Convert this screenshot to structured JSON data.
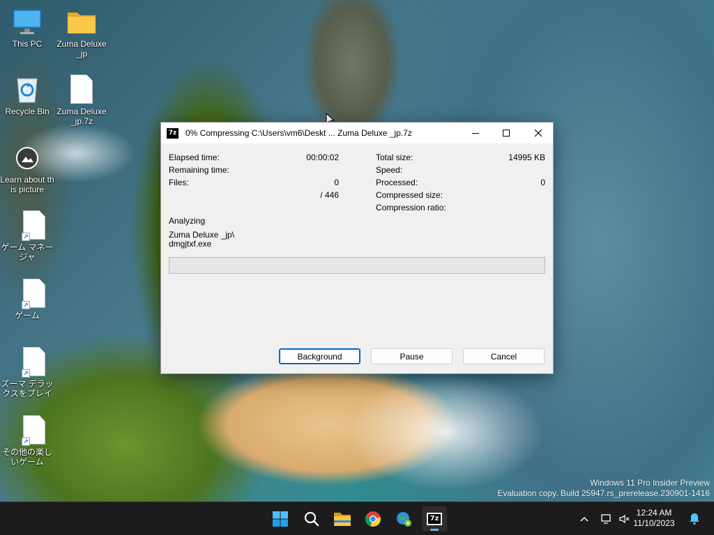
{
  "desktop": {
    "icons": [
      {
        "label": "This PC",
        "icon": "monitor-icon"
      },
      {
        "label": "Zuma Deluxe _jp",
        "icon": "folder-icon"
      },
      {
        "label": "Recycle Bin",
        "icon": "recycle-bin-icon"
      },
      {
        "label": "Zuma Deluxe _jp.7z",
        "icon": "file-icon"
      },
      {
        "label": "Learn about this picture",
        "icon": "camera-icon"
      },
      {
        "label": "ゲーム マネージャ",
        "icon": "shortcut-file-icon"
      },
      {
        "label": "ゲーム",
        "icon": "shortcut-file-icon"
      },
      {
        "label": "ズーマ デラックスをプレイ",
        "icon": "shortcut-file-icon"
      },
      {
        "label": "その他の楽しいゲーム",
        "icon": "shortcut-file-icon"
      }
    ],
    "watermark": {
      "line1": "Windows 11 Pro Insider Preview",
      "line2": "Evaluation copy. Build 25947.rs_prerelease.230901-1416"
    }
  },
  "dialog": {
    "title": "0% Compressing C:\\Users\\vm6\\Deskt ... Zuma Deluxe _jp.7z",
    "app_icon_text": "7z",
    "left_stats": {
      "elapsed_label": "Elapsed time:",
      "elapsed_value": "00:00:02",
      "remaining_label": "Remaining time:",
      "remaining_value": "",
      "files_label": "Files:",
      "files_value": "0",
      "files_total": "/ 446"
    },
    "right_stats": {
      "total_size_label": "Total size:",
      "total_size_value": "14995 KB",
      "speed_label": "Speed:",
      "speed_value": "",
      "processed_label": "Processed:",
      "processed_value": "0",
      "compressed_size_label": "Compressed size:",
      "compressed_size_value": "",
      "ratio_label": "Compression ratio:",
      "ratio_value": ""
    },
    "status": "Analyzing",
    "current_file_line1": "Zuma Deluxe _jp\\",
    "current_file_line2": "dmgjtxf.exe",
    "progress_percent": 0,
    "buttons": {
      "background": "Background",
      "pause": "Pause",
      "cancel": "Cancel"
    }
  },
  "taskbar": {
    "apps": [
      "start-icon",
      "search-icon",
      "file-explorer-icon",
      "chrome-icon",
      "app-icon",
      "7zip-icon"
    ],
    "clock_time": "12:24 AM",
    "clock_date": "11/10/2023",
    "accent": "#5fb2f2"
  }
}
